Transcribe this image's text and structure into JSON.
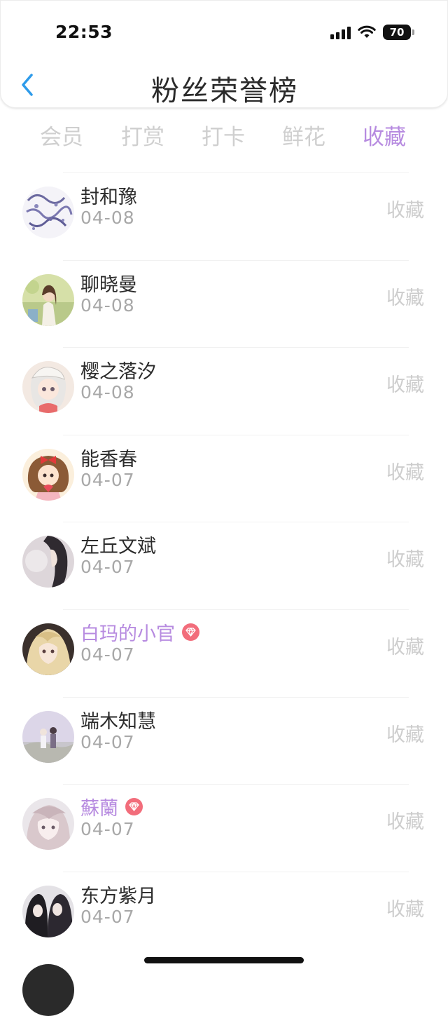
{
  "status": {
    "time": "22:53",
    "battery": "70"
  },
  "header": {
    "title": "粉丝荣誉榜"
  },
  "tabs": [
    "会员",
    "打赏",
    "打卡",
    "鲜花",
    "收藏"
  ],
  "active_tab": "收藏",
  "colors": {
    "accent": "#b78be0",
    "back": "#2e9bea",
    "vip": "#f26d7b"
  },
  "fans": [
    {
      "name": "封和豫",
      "date": "04-08",
      "action": "收藏",
      "vip": false,
      "avatar": "ink-pattern"
    },
    {
      "name": "聊晓曼",
      "date": "04-08",
      "action": "收藏",
      "vip": false,
      "avatar": "girl-garden"
    },
    {
      "name": "樱之落汐",
      "date": "04-08",
      "action": "收藏",
      "vip": false,
      "avatar": "anime-white-hair"
    },
    {
      "name": "能香春",
      "date": "04-07",
      "action": "收藏",
      "vip": false,
      "avatar": "cartoon-girl-bow"
    },
    {
      "name": "左丘文斌",
      "date": "04-07",
      "action": "收藏",
      "vip": false,
      "avatar": "dark-hair-girl"
    },
    {
      "name": "白玛的小官",
      "date": "04-07",
      "action": "收藏",
      "vip": true,
      "avatar": "anime-blonde"
    },
    {
      "name": "端木知慧",
      "date": "04-07",
      "action": "收藏",
      "vip": false,
      "avatar": "couple-scene"
    },
    {
      "name": "蘇蘭",
      "date": "04-07",
      "action": "收藏",
      "vip": true,
      "avatar": "anime-pink"
    },
    {
      "name": "东方紫月",
      "date": "04-07",
      "action": "收藏",
      "vip": false,
      "avatar": "two-girls"
    }
  ]
}
